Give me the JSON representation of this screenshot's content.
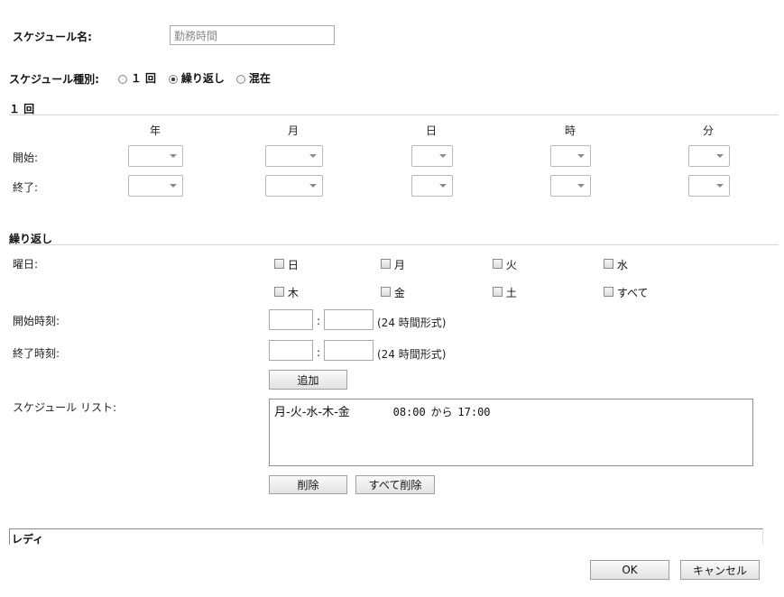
{
  "schedule_name": {
    "label": "スケジュール名:",
    "value": "勤務時間"
  },
  "schedule_type": {
    "label": "スケジュール種別:",
    "options": [
      {
        "label": "１ 回",
        "selected": false
      },
      {
        "label": "繰り返し",
        "selected": true
      },
      {
        "label": "混在",
        "selected": false
      }
    ]
  },
  "once": {
    "section_title": "１ 回",
    "columns": [
      "年",
      "月",
      "日",
      "時",
      "分"
    ],
    "start_label": "開始:",
    "end_label": "終了:"
  },
  "repeat": {
    "section_title": "繰り返し",
    "weekday_label": "曜日:",
    "days": [
      "日",
      "月",
      "火",
      "水",
      "木",
      "金",
      "土",
      "すべて"
    ],
    "start_time_label": "開始時刻:",
    "end_time_label": "終了時刻:",
    "time_separator": ":",
    "time_format_hint": "(24 時間形式)",
    "add_button": "追加",
    "schedule_list_label": "スケジュール リスト:",
    "schedule_list": [
      {
        "days": "月-火-水-木-金",
        "start": "08:00",
        "from_word": "から",
        "end": "17:00"
      }
    ],
    "delete_button": "削除",
    "delete_all_button": "すべて削除"
  },
  "status": {
    "text": "レディ"
  },
  "footer": {
    "ok_button": "OK",
    "cancel_button": "キャンセル"
  }
}
